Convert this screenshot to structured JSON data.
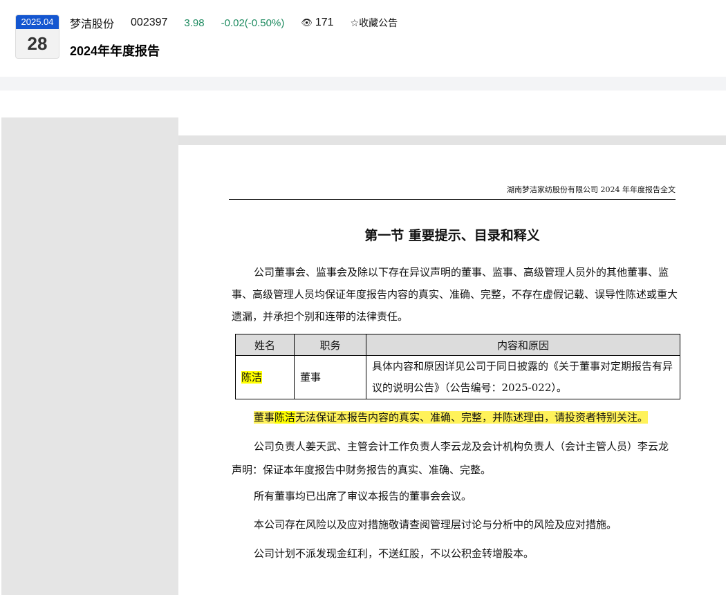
{
  "header": {
    "date_ym": "2025.04",
    "date_day": "28",
    "stock_name": "梦洁股份",
    "stock_code": "002397",
    "price": "3.98",
    "change": "-0.02(-0.50%)",
    "views": "171",
    "favorite_label": "☆收藏公告",
    "title": "2024年年度报告"
  },
  "colors": {
    "accent": "#1456d0",
    "change_green": "#1d8a5f",
    "highlight": "#ffff00"
  },
  "document": {
    "running_header": "湖南梦洁家纺股份有限公司 2024 年年度报告全文",
    "section_title": "第一节  重要提示、目录和释义",
    "para1": "公司董事会、监事会及除以下存在异议声明的董事、监事、高级管理人员外的其他董事、监事、高级管理人员均保证年度报告内容的真实、准确、完整，不存在虚假记载、误导性陈述或重大遗漏，并承担个别和连带的法律责任。",
    "table": {
      "headers": [
        "姓名",
        "职务",
        "内容和原因"
      ],
      "rows": [
        [
          "陈洁",
          "董事",
          "具体内容和原因详见公司于同日披露的《关于董事对定期报告有异议的说明公告》（公告编号：2025-022）。"
        ]
      ]
    },
    "warning_prefix": "董事",
    "warning_name": "陈洁",
    "warning_rest": "无法保证本报告内容的真实、准确、完整，并陈述理由，请投资者特别关注。",
    "para2": "公司负责人姜天武、主管会计工作负责人李云龙及会计机构负责人（会计主管人员）李云龙声明：保证本年度报告中财务报告的真实、准确、完整。",
    "para3": "所有董事均已出席了审议本报告的董事会会议。",
    "para4": "本公司存在风险以及应对措施敬请查阅管理层讨论与分析中的风险及应对措施。",
    "para5": "公司计划不派发现金红利，不送红股，不以公积金转增股本。"
  }
}
